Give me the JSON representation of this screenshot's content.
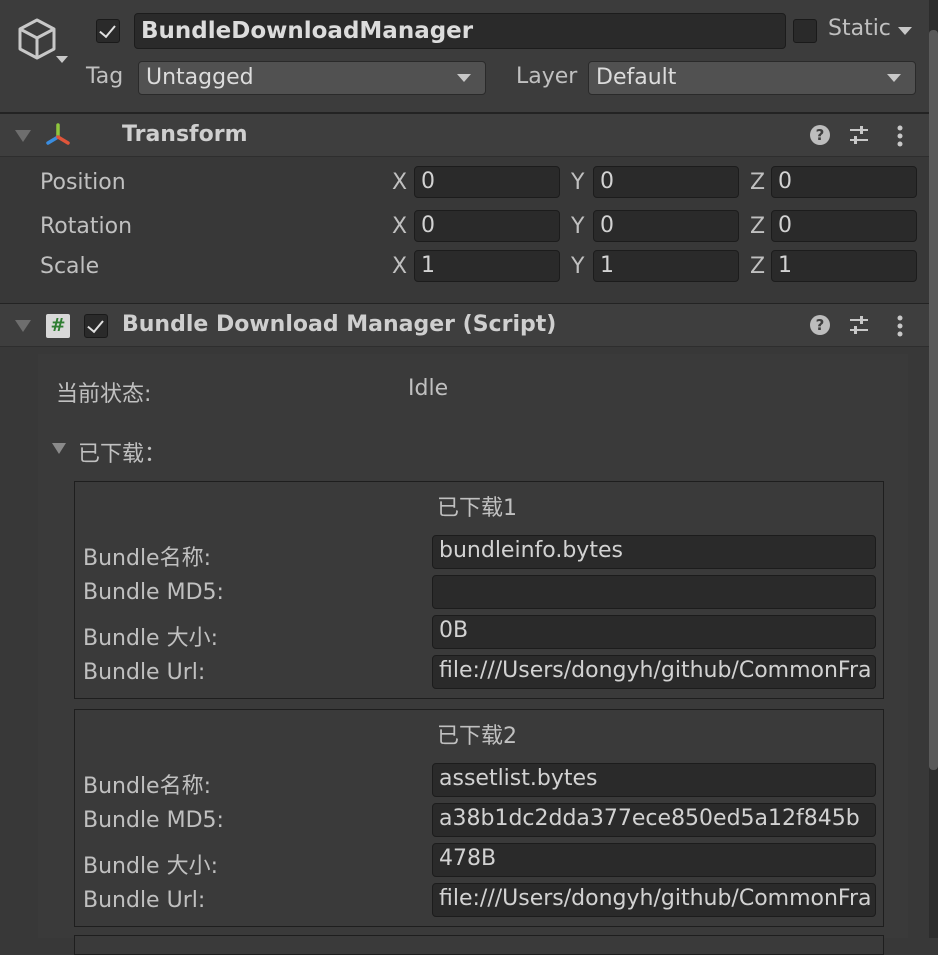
{
  "gameobject": {
    "name": "BundleDownloadManager",
    "static_label": "Static",
    "tag_label": "Tag",
    "tag_value": "Untagged",
    "layer_label": "Layer",
    "layer_value": "Default"
  },
  "transform": {
    "title": "Transform",
    "rows": [
      {
        "label": "Position",
        "x": "0",
        "y": "0",
        "z": "0"
      },
      {
        "label": "Rotation",
        "x": "0",
        "y": "0",
        "z": "0"
      },
      {
        "label": "Scale",
        "x": "1",
        "y": "1",
        "z": "1"
      }
    ],
    "axis_x": "X",
    "axis_y": "Y",
    "axis_z": "Z"
  },
  "script": {
    "title": "Bundle Download Manager (Script)",
    "icon_glyph": "#",
    "status_label": "当前状态:",
    "status_value": "Idle",
    "downloaded_label": "已下载：",
    "items": [
      {
        "title": "已下载1",
        "name_label": "Bundle名称:",
        "name_value": "bundleinfo.bytes",
        "md5_label": "Bundle MD5:",
        "md5_value": "",
        "size_label": "Bundle 大小:",
        "size_value": "0B",
        "url_label": "Bundle Url:",
        "url_value": "file:///Users/dongyh/github/CommonFra"
      },
      {
        "title": "已下载2",
        "name_label": "Bundle名称:",
        "name_value": "assetlist.bytes",
        "md5_label": "Bundle MD5:",
        "md5_value": "a38b1dc2dda377ece850ed5a12f845b",
        "size_label": "Bundle 大小:",
        "size_value": "478B",
        "url_label": "Bundle Url:",
        "url_value": "file:///Users/dongyh/github/CommonFra"
      }
    ]
  },
  "colors": {
    "background": "#383838",
    "field": "#2a2a2a",
    "header": "#3e3e3e"
  }
}
